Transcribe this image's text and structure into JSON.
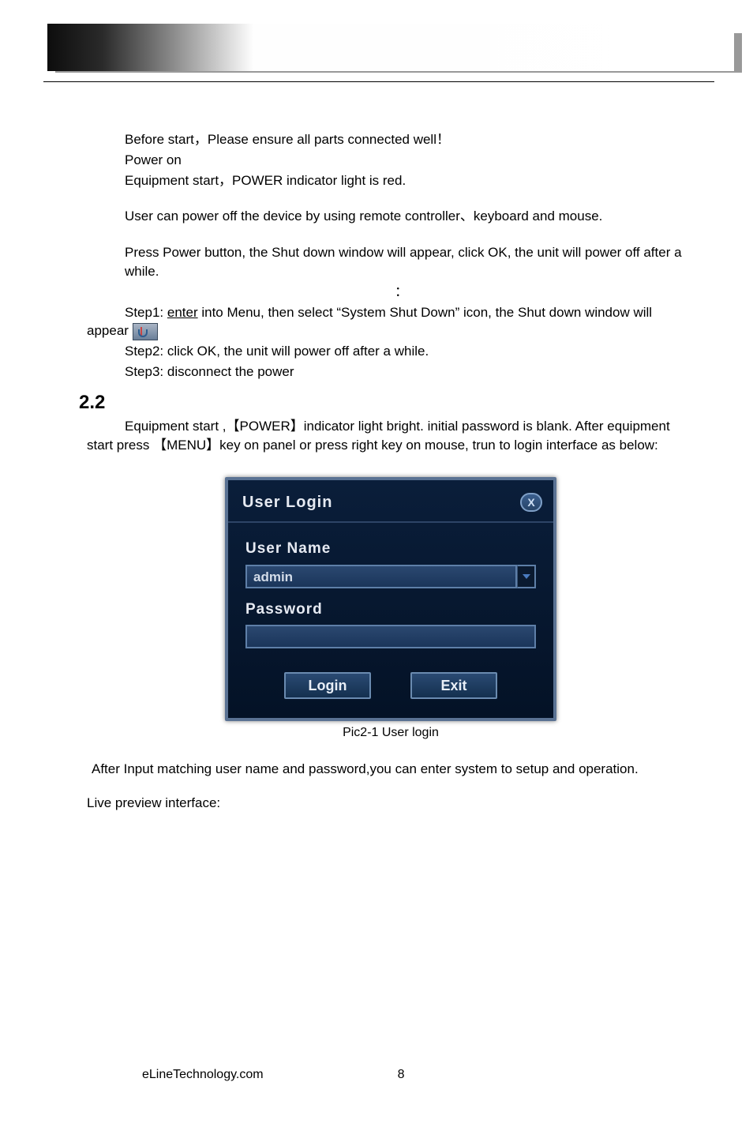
{
  "para": {
    "p1": "Before start，Please ensure all parts connected well！",
    "p2": "Power on",
    "p3": "Equipment start，POWER indicator light is red.",
    "p4": "User can power off the device by using remote controller、keyboard and mouse.",
    "p5": "Press Power button, the Shut down window will appear, click OK, the unit will power off after a while.",
    "p6_colon": "：",
    "p7a": "Step1: ",
    "p7b": "enter",
    "p7c": " into Menu, then select “System Shut Down” icon, the Shut down window will appear ",
    "p8": "Step2: click OK, the unit will power off after a while.",
    "p9": "Step3: disconnect the power",
    "section_num": "2.2",
    "p10": "Equipment start ,【POWER】indicator light bright. initial password is blank. After equipment start press  【MENU】key on panel or press right key on mouse, trun to login interface as below:",
    "caption": "Pic2-1   User login",
    "p11": "After Input matching user name and password,you can enter system to setup and operation.",
    "p12": "Live preview interface:"
  },
  "login": {
    "title": "User  Login",
    "close": "X",
    "user_label": "User  Name",
    "user_value": "admin",
    "pwd_label": "Password",
    "pwd_value": "",
    "login_btn": "Login",
    "exit_btn": "Exit"
  },
  "footer": {
    "site": "eLineTechnology.com",
    "page": "8"
  }
}
